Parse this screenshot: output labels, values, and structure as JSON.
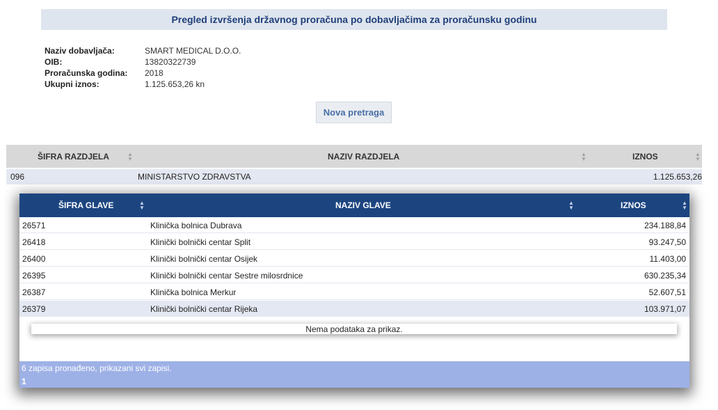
{
  "page": {
    "title": "Pregled izvršenja državnog proračuna po dobavljačima za proračunsku godinu"
  },
  "supplier": {
    "labels": {
      "name": "Naziv dobavljača:",
      "oib": "OIB:",
      "year": "Proračunska godina:",
      "total": "Ukupni iznos:"
    },
    "values": {
      "name": "SMART MEDICAL D.O.O.",
      "oib": "13820322739",
      "year": "2018",
      "total": "1.125.653,26 kn"
    }
  },
  "actions": {
    "new_search": "Nova pretraga"
  },
  "outer_table": {
    "headers": {
      "code": "ŠIFRA RAZDJELA",
      "name": "NAZIV RAZDJELA",
      "amount": "IZNOS"
    },
    "row": {
      "code": "096",
      "name": "MINISTARSTVO ZDRAVSTVA",
      "amount": "1.125.653,26"
    }
  },
  "inner_table": {
    "headers": {
      "code": "ŠIFRA GLAVE",
      "name": "NAZIV GLAVE",
      "amount": "IZNOS"
    },
    "rows": [
      {
        "code": "26571",
        "name": "Klinička bolnica Dubrava",
        "amount": "234.188,84"
      },
      {
        "code": "26418",
        "name": "Klinički bolnički centar Split",
        "amount": "93.247,50"
      },
      {
        "code": "26400",
        "name": "Klinički bolnički centar Osijek",
        "amount": "11.403,00"
      },
      {
        "code": "26395",
        "name": "Klinički bolnički centar Sestre milosrdnice",
        "amount": "630.235,34"
      },
      {
        "code": "26387",
        "name": "Klinička bolnica Merkur",
        "amount": "52.607,51"
      },
      {
        "code": "26379",
        "name": "Klinički bolnički centar Rijeka",
        "amount": "103.971,07"
      }
    ],
    "no_data": "Nema podataka za prikaz.",
    "summary": "6 zapisa pronađeno, prikazani svi zapisi.",
    "page": "1"
  },
  "icons": {
    "sort": "sort-updown-icon"
  },
  "colors": {
    "title_bg": "#dfe5ee",
    "inner_header_bg": "#1c4580",
    "footer_bg": "#9eb1e6",
    "selected_row_bg": "#e4e8f2"
  }
}
